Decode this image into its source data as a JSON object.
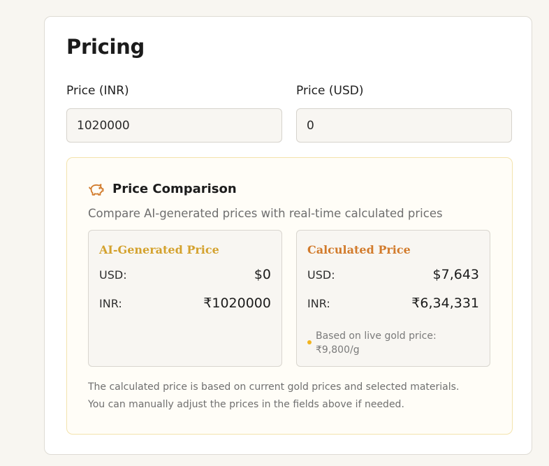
{
  "pricing": {
    "title": "Pricing",
    "inr_label": "Price (INR)",
    "usd_label": "Price (USD)",
    "inr_value": "1020000",
    "usd_value": "0"
  },
  "comparison": {
    "icon": "piggy-bank-icon",
    "title": "Price Comparison",
    "subtitle": "Compare AI-generated prices with real-time calculated prices",
    "ai": {
      "heading": "AI-Generated Price",
      "usd_label": "USD:",
      "usd_value": "$0",
      "inr_label": "INR:",
      "inr_value": "₹1020000"
    },
    "calculated": {
      "heading": "Calculated Price",
      "usd_label": "USD:",
      "usd_value": "$7,643",
      "inr_label": "INR:",
      "inr_value": "₹6,34,331",
      "note": "Based on live gold price: ₹9,800/g"
    },
    "footer_line1": "The calculated price is based on current gold prices and selected materials.",
    "footer_line2": "You can manually adjust the prices in the fields above if needed."
  },
  "colors": {
    "accent_orange": "#d27b2c",
    "accent_gold": "#d4a22e",
    "panel_border": "#f3e3ad"
  }
}
